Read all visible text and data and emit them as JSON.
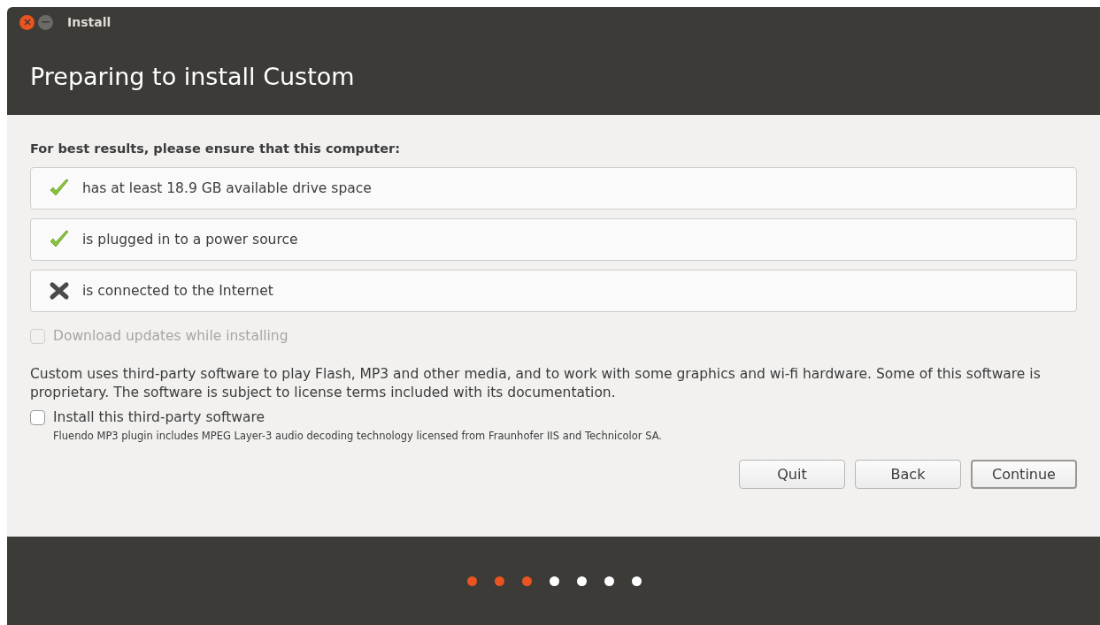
{
  "window": {
    "title": "Install"
  },
  "header": {
    "title": "Preparing to install Custom"
  },
  "requirements": {
    "heading": "For best results, please ensure that this computer:",
    "items": [
      {
        "label": "has at least 18.9 GB available drive space",
        "met": true
      },
      {
        "label": "is plugged in to a power source",
        "met": true
      },
      {
        "label": "is connected to the Internet",
        "met": false
      }
    ]
  },
  "download_updates": {
    "label": "Download updates while installing",
    "checked": false,
    "disabled": true
  },
  "third_party": {
    "description": "Custom uses third-party software to play Flash, MP3 and other media, and to work with some graphics and wi-fi hardware. Some of this software is proprietary. The software is subject to license terms included with its documentation.",
    "label": "Install this third-party software",
    "checked": false,
    "disabled": false,
    "note": "Fluendo MP3 plugin includes MPEG Layer-3 audio decoding technology licensed from Fraunhofer IIS and Technicolor SA."
  },
  "buttons": [
    {
      "label": "Quit",
      "default": false
    },
    {
      "label": "Back",
      "default": false
    },
    {
      "label": "Continue",
      "default": true
    }
  ],
  "progress": [
    {
      "selected": true
    },
    {
      "selected": true
    },
    {
      "selected": true
    },
    {
      "selected": false
    },
    {
      "selected": false
    },
    {
      "selected": false
    },
    {
      "selected": false
    }
  ]
}
